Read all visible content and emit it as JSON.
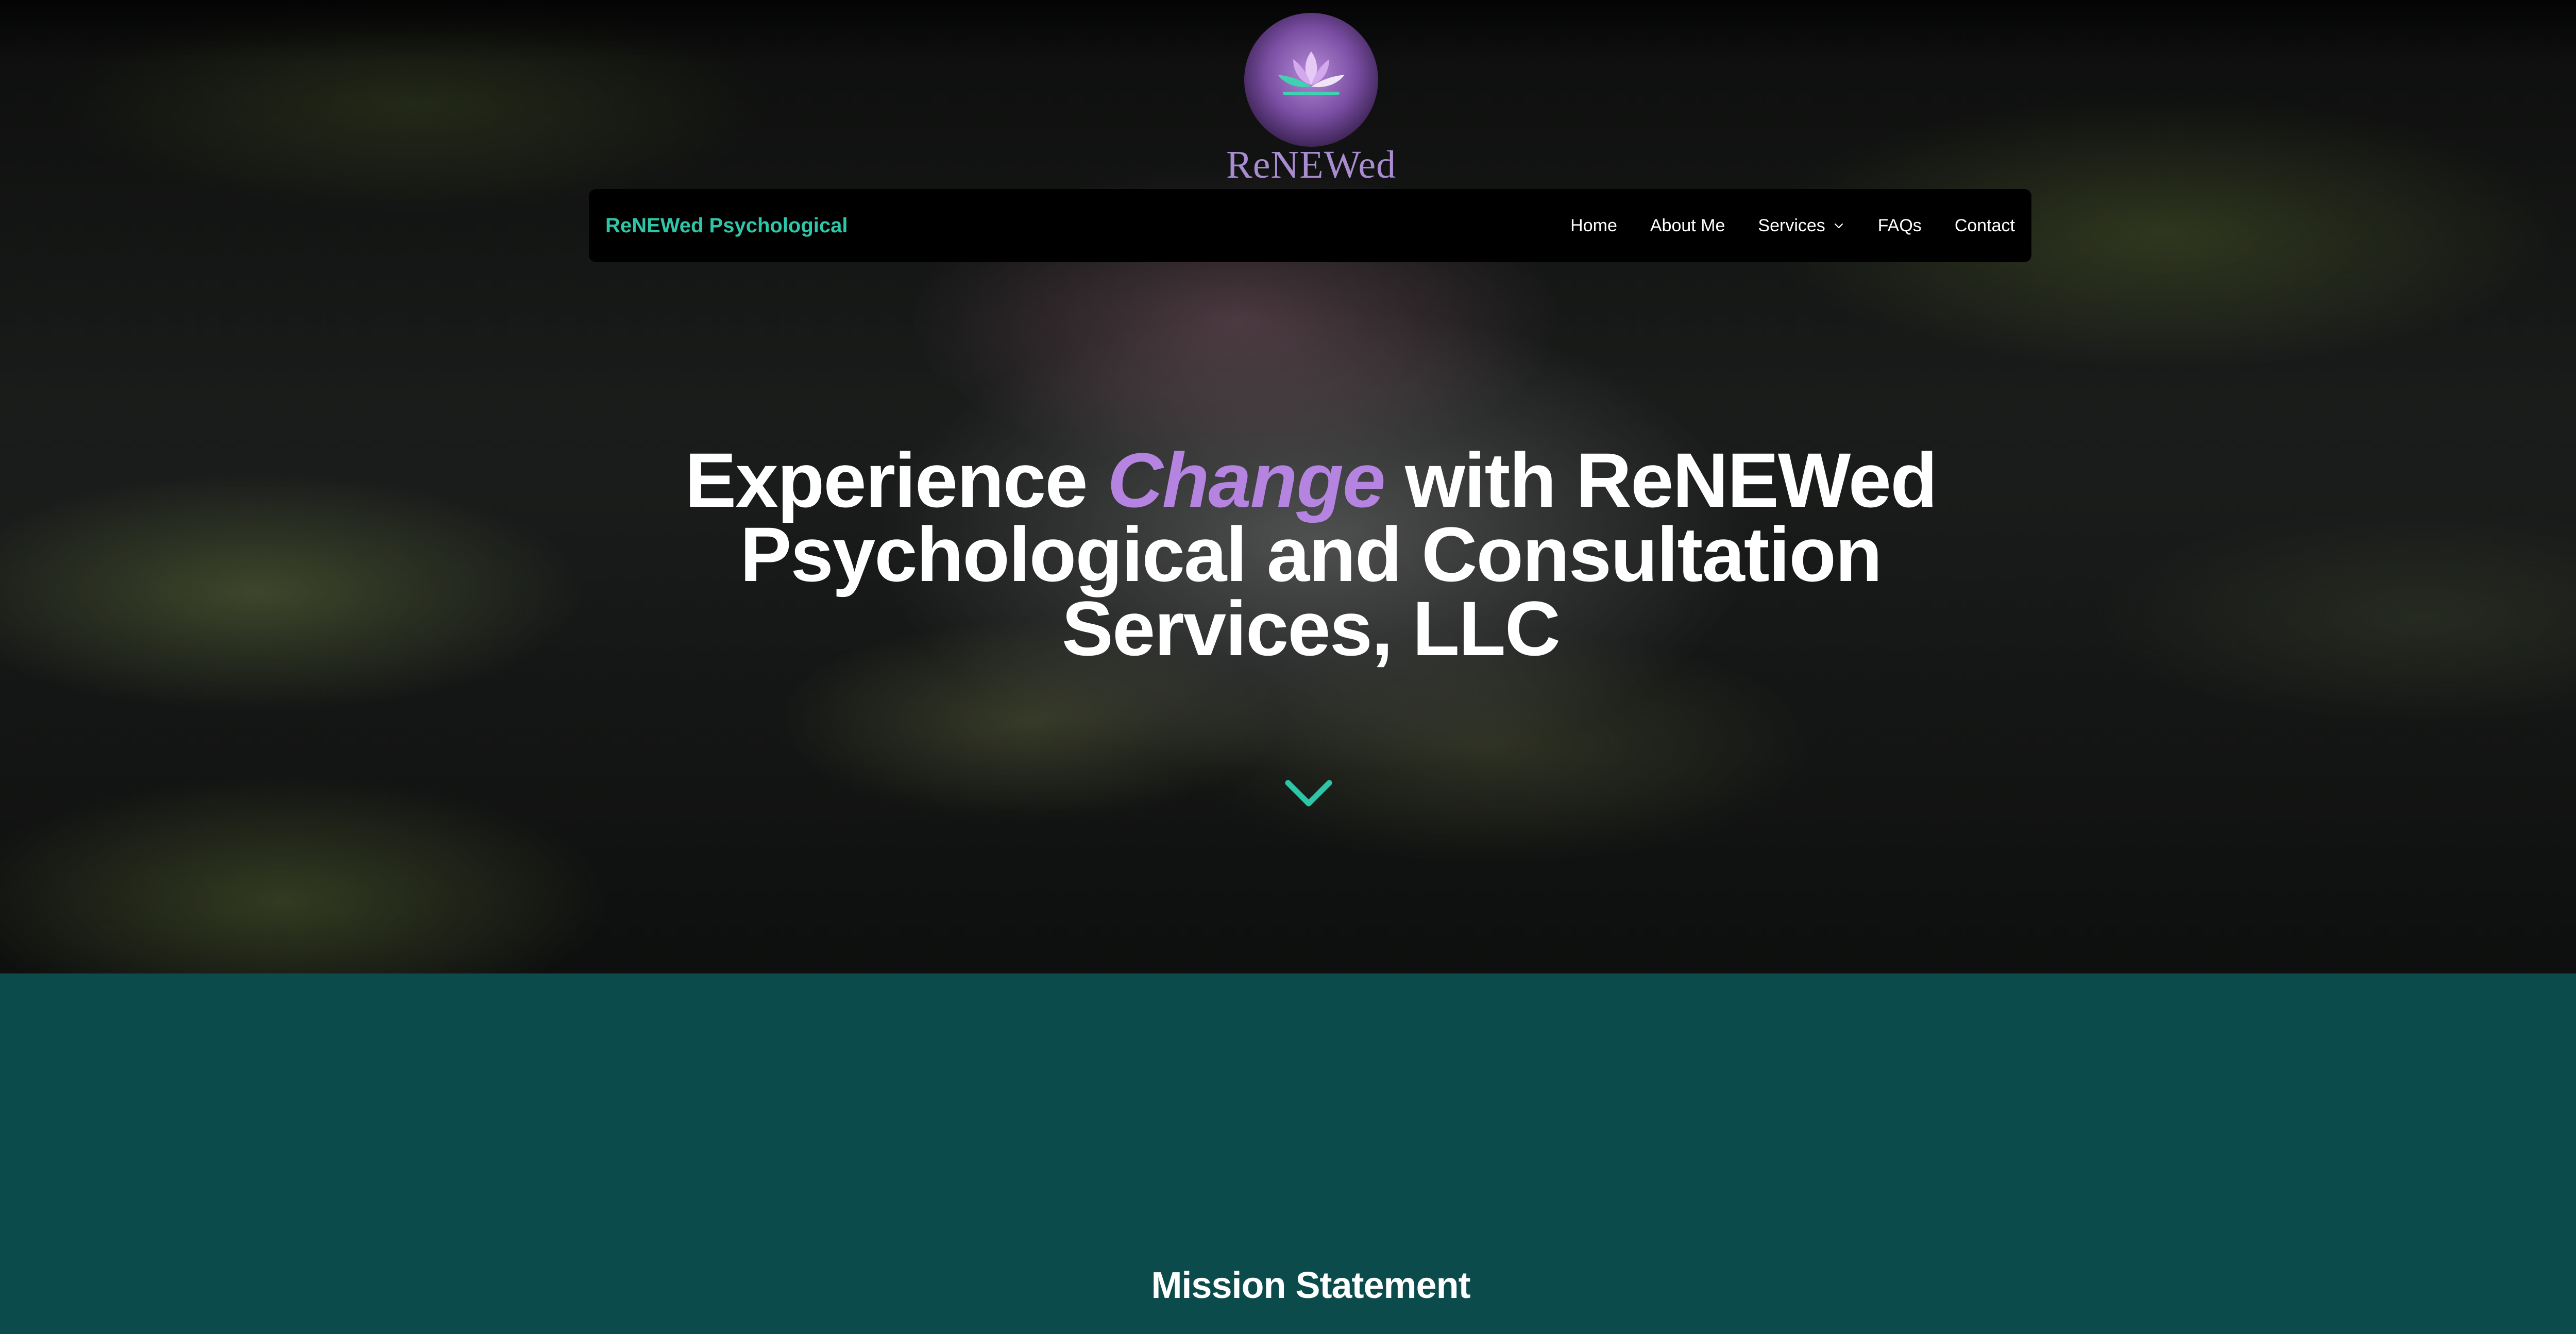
{
  "logo": {
    "text": "ReNEWed"
  },
  "nav": {
    "brand": "ReNEWed Psychological",
    "items": [
      {
        "label": "Home"
      },
      {
        "label": "About Me"
      },
      {
        "label": "Services",
        "has_dropdown": true
      },
      {
        "label": "FAQs"
      },
      {
        "label": "Contact"
      }
    ]
  },
  "hero": {
    "headline_pre": "Experience ",
    "headline_accent": "Change",
    "headline_post": " with ReNEWed Psychological and Consultation Services, LLC",
    "scroll_icon": "chevron-down-icon"
  },
  "mission": {
    "title": "Mission Statement"
  },
  "colors": {
    "brand_teal": "#2fc6a8",
    "accent_purple": "#b583e0",
    "section_teal": "#0b4b4b",
    "nav_bg": "#000000"
  }
}
